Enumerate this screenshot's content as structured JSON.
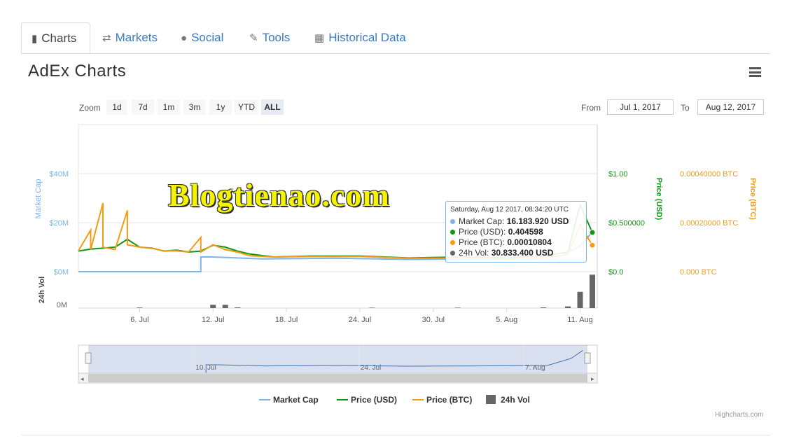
{
  "tabs": [
    {
      "label": "Charts",
      "icon": "bar-chart-icon",
      "active": true
    },
    {
      "label": "Markets",
      "icon": "exchange-icon",
      "active": false
    },
    {
      "label": "Social",
      "icon": "globe-icon",
      "active": false
    },
    {
      "label": "Tools",
      "icon": "wrench-icon",
      "active": false
    },
    {
      "label": "Historical Data",
      "icon": "calendar-icon",
      "active": false
    }
  ],
  "title": "AdEx Charts",
  "zoom": {
    "label": "Zoom",
    "buttons": [
      "1d",
      "7d",
      "1m",
      "3m",
      "1y",
      "YTD",
      "ALL"
    ],
    "selected": "ALL"
  },
  "range": {
    "from_label": "From",
    "from_value": "Jul 1, 2017",
    "to_label": "To",
    "to_value": "Aug 12, 2017"
  },
  "watermark": "Blogtienao.com",
  "tooltip": {
    "header": "Saturday, Aug 12 2017, 08:34:20 UTC",
    "rows": [
      {
        "name": "Market Cap",
        "value": "16.183.920 USD",
        "color": "#7cb5ec"
      },
      {
        "name": "Price (USD)",
        "value": "0.404598",
        "color": "#109618"
      },
      {
        "name": "Price (BTC)",
        "value": "0.00010804",
        "color": "#f39c12"
      },
      {
        "name": "24h Vol",
        "value": "30.833.400 USD",
        "color": "#666666"
      }
    ]
  },
  "legend": [
    {
      "name": "Market Cap",
      "color": "#7cb5ec",
      "symbol": "line"
    },
    {
      "name": "Price (USD)",
      "color": "#109618",
      "symbol": "line"
    },
    {
      "name": "Price (BTC)",
      "color": "#f39c12",
      "symbol": "line"
    },
    {
      "name": "24h Vol",
      "color": "#666666",
      "symbol": "square"
    }
  ],
  "credits": "Highcharts.com",
  "colors": {
    "market_cap": "#7cb5ec",
    "price_usd": "#109618",
    "price_btc": "#f39c12",
    "volume": "#666666",
    "tab_link": "#3a7cc0"
  },
  "chart_data": {
    "type": "line",
    "x_start": "2017-07-01",
    "x_end": "2017-08-12",
    "x_tick_labels": [
      "6. Jul",
      "12. Jul",
      "18. Jul",
      "24. Jul",
      "30. Jul",
      "5. Aug",
      "11. Aug"
    ],
    "x_tick_dates": [
      "2017-07-06",
      "2017-07-12",
      "2017-07-18",
      "2017-07-24",
      "2017-07-30",
      "2017-08-05",
      "2017-08-11"
    ],
    "axes": {
      "market_cap": {
        "label": "Market Cap",
        "ticks": [
          "$0M",
          "$20M",
          "$40M"
        ],
        "tick_values": [
          0,
          20,
          40
        ],
        "range": [
          0,
          40
        ],
        "unit": "M USD"
      },
      "price_usd": {
        "label": "Price (USD)",
        "ticks": [
          "$0.0",
          "$0.500000",
          "$1.00"
        ],
        "tick_values": [
          0,
          0.5,
          1.0
        ],
        "range": [
          0,
          1.0
        ]
      },
      "price_btc": {
        "label": "Price (BTC)",
        "ticks": [
          "0.000 BTC",
          "0.00020000 BTC",
          "0.00040000 BTC"
        ],
        "tick_values": [
          0,
          0.0002,
          0.0004
        ],
        "range": [
          0,
          0.0004
        ]
      },
      "volume": {
        "label": "24h Vol",
        "ticks": [
          "0M"
        ],
        "tick_values": [
          0
        ]
      }
    },
    "navigator_tick_labels": [
      "10. Jul",
      "24. Jul",
      "7. Aug"
    ],
    "navigator_tick_dates": [
      "2017-07-10",
      "2017-07-24",
      "2017-08-07"
    ],
    "grid": true,
    "legend_position": "bottom",
    "series": [
      {
        "name": "Market Cap",
        "axis": "market_cap",
        "dates": [
          "2017-07-01",
          "2017-07-11",
          "2017-07-11",
          "2017-07-12",
          "2017-07-16",
          "2017-07-22",
          "2017-07-28",
          "2017-08-03",
          "2017-08-09",
          "2017-08-11",
          "2017-08-12"
        ],
        "values": [
          0,
          0,
          6.0,
          6.0,
          5.2,
          5.5,
          5.0,
          5.2,
          5.5,
          10.5,
          16.2
        ]
      },
      {
        "name": "Price (USD)",
        "axis": "price_usd",
        "dates": [
          "2017-07-01",
          "2017-07-02",
          "2017-07-03",
          "2017-07-04",
          "2017-07-05",
          "2017-07-06",
          "2017-07-07",
          "2017-07-08",
          "2017-07-09",
          "2017-07-10",
          "2017-07-11",
          "2017-07-12",
          "2017-07-13",
          "2017-07-14",
          "2017-07-15",
          "2017-07-17",
          "2017-07-20",
          "2017-07-24",
          "2017-07-28",
          "2017-08-01",
          "2017-08-05",
          "2017-08-08",
          "2017-08-10",
          "2017-08-11",
          "2017-08-12"
        ],
        "values": [
          0.21,
          0.23,
          0.24,
          0.25,
          0.33,
          0.25,
          0.24,
          0.21,
          0.22,
          0.2,
          0.21,
          0.27,
          0.25,
          0.21,
          0.18,
          0.15,
          0.16,
          0.16,
          0.14,
          0.15,
          0.14,
          0.16,
          0.2,
          0.68,
          0.4
        ]
      },
      {
        "name": "Price (BTC)",
        "axis": "price_btc",
        "dates": [
          "2017-07-01",
          "2017-07-02",
          "2017-07-02",
          "2017-07-03",
          "2017-07-03",
          "2017-07-04",
          "2017-07-05",
          "2017-07-05",
          "2017-07-06",
          "2017-07-07",
          "2017-07-08",
          "2017-07-09",
          "2017-07-10",
          "2017-07-11",
          "2017-07-11",
          "2017-07-12",
          "2017-07-13",
          "2017-07-14",
          "2017-07-15",
          "2017-07-17",
          "2017-07-20",
          "2017-07-24",
          "2017-07-28",
          "2017-08-01",
          "2017-08-05",
          "2017-08-08",
          "2017-08-10",
          "2017-08-11",
          "2017-08-12"
        ],
        "values": [
          8.5e-05,
          0.00017,
          9e-05,
          0.00028,
          0.0001,
          9e-05,
          0.00025,
          0.00011,
          0.0001,
          9.5e-05,
          8.5e-05,
          8.5e-05,
          8e-05,
          0.00014,
          8e-05,
          0.00011,
          9e-05,
          8e-05,
          6.5e-05,
          6e-05,
          6.2e-05,
          6.2e-05,
          5.5e-05,
          5.5e-05,
          5e-05,
          5.5e-05,
          7e-05,
          0.00019,
          0.000108
        ]
      },
      {
        "name": "24h Vol",
        "axis": "volume",
        "type": "column",
        "dates": [
          "2017-07-06",
          "2017-07-12",
          "2017-07-13",
          "2017-07-14",
          "2017-07-25",
          "2017-08-01",
          "2017-08-08",
          "2017-08-10",
          "2017-08-11",
          "2017-08-12"
        ],
        "values": [
          0.5,
          3.0,
          3.0,
          0.6,
          0.4,
          0.4,
          0.6,
          1.5,
          15.0,
          30.8
        ]
      }
    ]
  }
}
